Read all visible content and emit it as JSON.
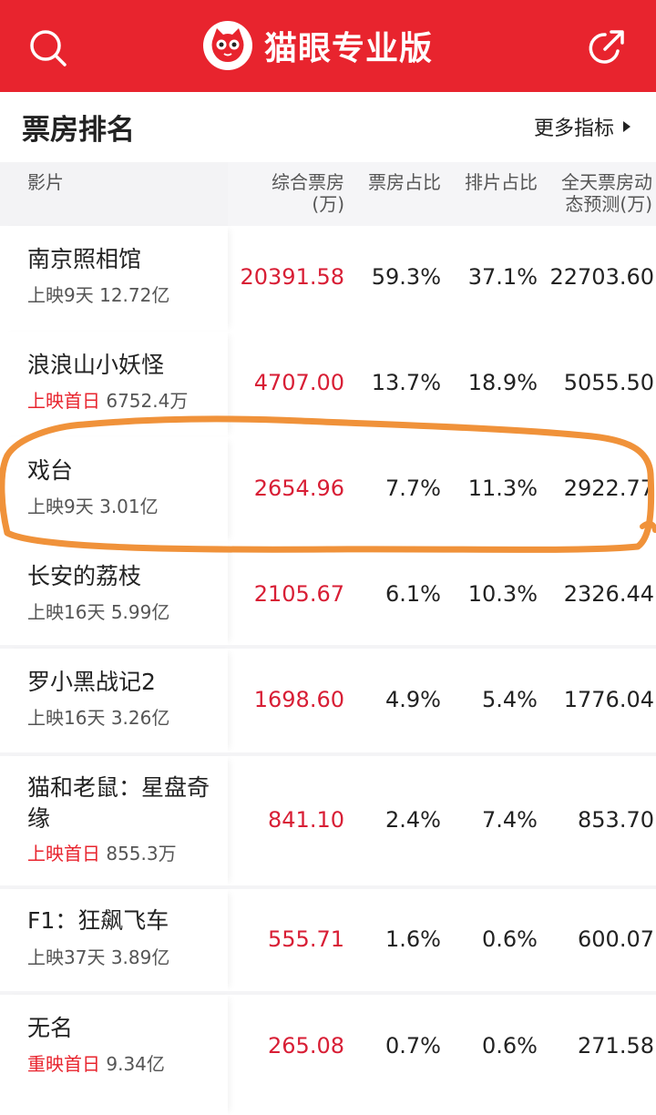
{
  "header": {
    "app_name": "猫眼专业版",
    "search_icon": "search-icon",
    "share_icon": "share-icon",
    "brand_color": "#e8242e"
  },
  "section": {
    "title": "票房排名",
    "more_label": "更多指标"
  },
  "columns": {
    "film": "影片",
    "box_line1": "综合票房",
    "box_line2": "(万)",
    "share": "票房占比",
    "sched": "排片占比",
    "pred_line1": "全天票房动",
    "pred_line2": "态预测(万)"
  },
  "rows": [
    {
      "title": "南京照相馆",
      "status": "上映9天",
      "status_red": false,
      "total": "12.72亿",
      "box": "20391.58",
      "share": "59.3%",
      "sched": "37.1%",
      "pred": "22703.60"
    },
    {
      "title": "浪浪山小妖怪",
      "status": "上映首日",
      "status_red": true,
      "total": "6752.4万",
      "box": "4707.00",
      "share": "13.7%",
      "sched": "18.9%",
      "pred": "5055.50"
    },
    {
      "title": "戏台",
      "status": "上映9天",
      "status_red": false,
      "total": "3.01亿",
      "box": "2654.96",
      "share": "7.7%",
      "sched": "11.3%",
      "pred": "2922.77"
    },
    {
      "title": "长安的荔枝",
      "status": "上映16天",
      "status_red": false,
      "total": "5.99亿",
      "box": "2105.67",
      "share": "6.1%",
      "sched": "10.3%",
      "pred": "2326.44"
    },
    {
      "title": "罗小黑战记2",
      "status": "上映16天",
      "status_red": false,
      "total": "3.26亿",
      "box": "1698.60",
      "share": "4.9%",
      "sched": "5.4%",
      "pred": "1776.04"
    },
    {
      "title": "猫和老鼠：星盘奇缘",
      "status": "上映首日",
      "status_red": true,
      "total": "855.3万",
      "box": "841.10",
      "share": "2.4%",
      "sched": "7.4%",
      "pred": "853.70"
    },
    {
      "title": "F1：狂飙飞车",
      "status": "上映37天",
      "status_red": false,
      "total": "3.89亿",
      "box": "555.71",
      "share": "1.6%",
      "sched": "0.6%",
      "pred": "600.07"
    },
    {
      "title": "无名",
      "status": "重映首日",
      "status_red": true,
      "total": "9.34亿",
      "box": "265.08",
      "share": "0.7%",
      "sched": "0.6%",
      "pred": "271.58"
    }
  ],
  "annotation": {
    "color": "#f0923a",
    "target": "戏台"
  }
}
